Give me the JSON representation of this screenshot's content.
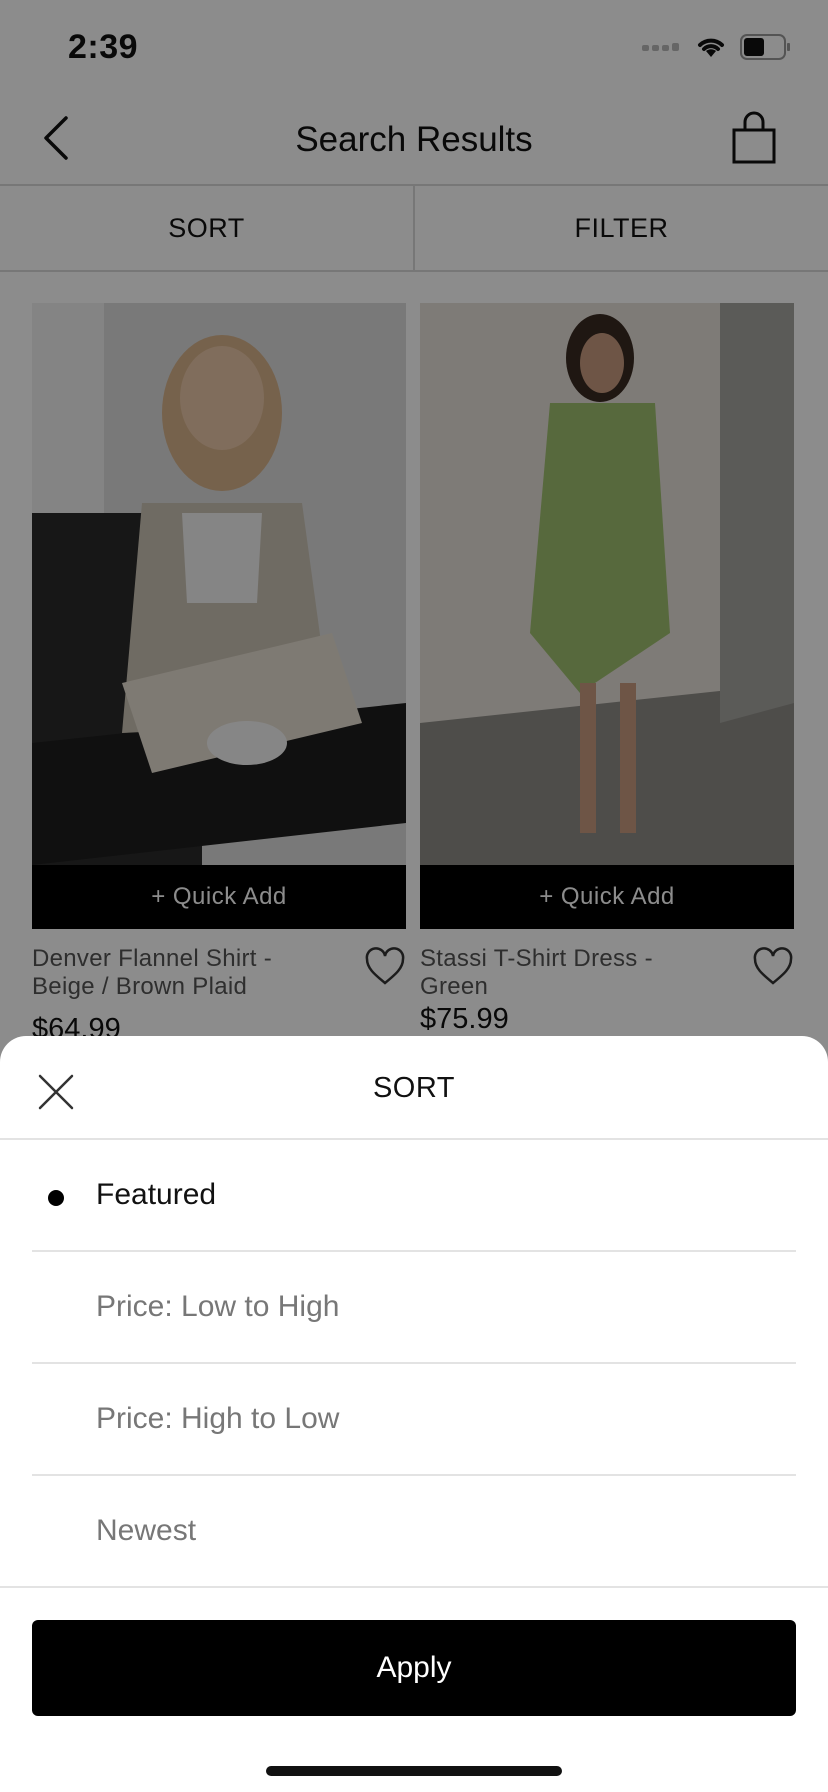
{
  "status_bar": {
    "time": "2:39"
  },
  "header": {
    "title": "Search Results"
  },
  "toolbar": {
    "sort_label": "SORT",
    "filter_label": "FILTER"
  },
  "products": [
    {
      "name": "Denver Flannel Shirt - Beige / Brown Plaid",
      "price": "$64.99",
      "quick_add": "+ Quick Add"
    },
    {
      "name": "Stassi T-Shirt Dress - Green",
      "price": "$75.99",
      "quick_add": "+ Quick Add"
    }
  ],
  "sort_sheet": {
    "title": "SORT",
    "options": [
      {
        "label": "Featured",
        "selected": true
      },
      {
        "label": "Price: Low to High",
        "selected": false
      },
      {
        "label": "Price: High to Low",
        "selected": false
      },
      {
        "label": "Newest",
        "selected": false
      }
    ],
    "apply_label": "Apply"
  },
  "icons": [
    "back-arrow-icon",
    "shopping-bag-icon",
    "heart-icon",
    "close-icon",
    "wifi-icon",
    "battery-icon",
    "signal-icon"
  ],
  "colors": {
    "accent": "#000000",
    "overlay": "rgba(0,0,0,0.45)",
    "divider": "#d9d9d9",
    "secondary_text": "#777777"
  }
}
